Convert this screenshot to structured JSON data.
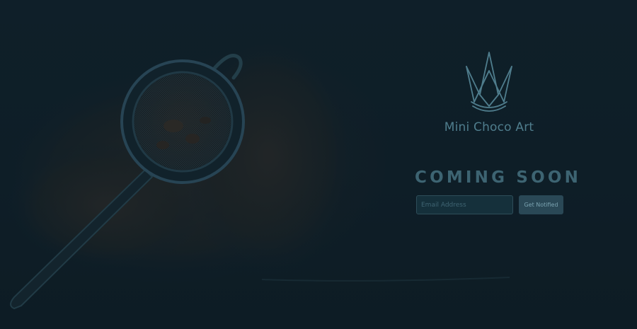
{
  "brand": {
    "name": "Mini Choco Art",
    "logo_icon": "crown-logo-icon"
  },
  "hero": {
    "image": "sieve-over-cocoa-powder-image"
  },
  "main": {
    "heading": "COMING SOON"
  },
  "signup": {
    "email_placeholder": "Email Address",
    "email_value": "",
    "button_label": "Get Notified"
  },
  "colors": {
    "background": "#0e1d24",
    "accent_text": "#4f7d8d",
    "heading": "#3d6472",
    "button_bg": "#2a4856"
  }
}
